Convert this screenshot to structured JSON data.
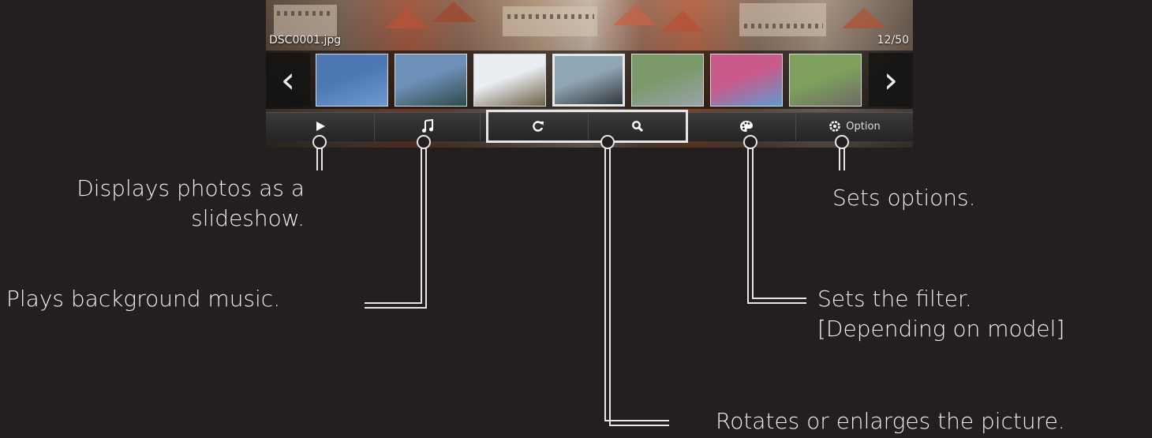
{
  "viewer": {
    "filename": "DSC0001.jpg",
    "counter": "12/50",
    "nav": {
      "prev_icon": "chevron-left-icon",
      "next_icon": "chevron-right-icon"
    },
    "thumbnails": [
      {
        "name": "thumb-sky",
        "colors": [
          "#4d78b4",
          "#6f99cf"
        ]
      },
      {
        "name": "thumb-river",
        "colors": [
          "#6d8fb8",
          "#2e4a4a"
        ]
      },
      {
        "name": "thumb-church",
        "colors": [
          "#eaeef2",
          "#6d6048"
        ]
      },
      {
        "name": "thumb-gondolas",
        "colors": [
          "#8fa6b4",
          "#33363a"
        ]
      },
      {
        "name": "thumb-street",
        "colors": [
          "#7a9a6a",
          "#9aa3a8"
        ]
      },
      {
        "name": "thumb-graffiti",
        "colors": [
          "#c95a8a",
          "#5f9ad1"
        ]
      },
      {
        "name": "thumb-railway",
        "colors": [
          "#7ea25e",
          "#6d6a63"
        ]
      }
    ],
    "selected_thumbnail": 3,
    "controls": {
      "slideshow_icon": "play-icon",
      "music_icon": "music-note-icon",
      "rotate_icon": "rotate-icon",
      "zoom_icon": "magnifier-icon",
      "filter_icon": "palette-icon",
      "option_icon": "gear-icon",
      "option_label": "Option"
    }
  },
  "callouts": {
    "slideshow_line1": "Displays photos as a",
    "slideshow_line2": "slideshow.",
    "music": "Plays background music.",
    "options": "Sets options.",
    "filter_line1": "Sets the filter.",
    "filter_line2": "[Depending on model]",
    "rotate_zoom": "Rotates or enlarges the picture."
  },
  "colors": {
    "background": "#231f20",
    "text": "#f0f0f0",
    "line": "#e6e6e6"
  }
}
